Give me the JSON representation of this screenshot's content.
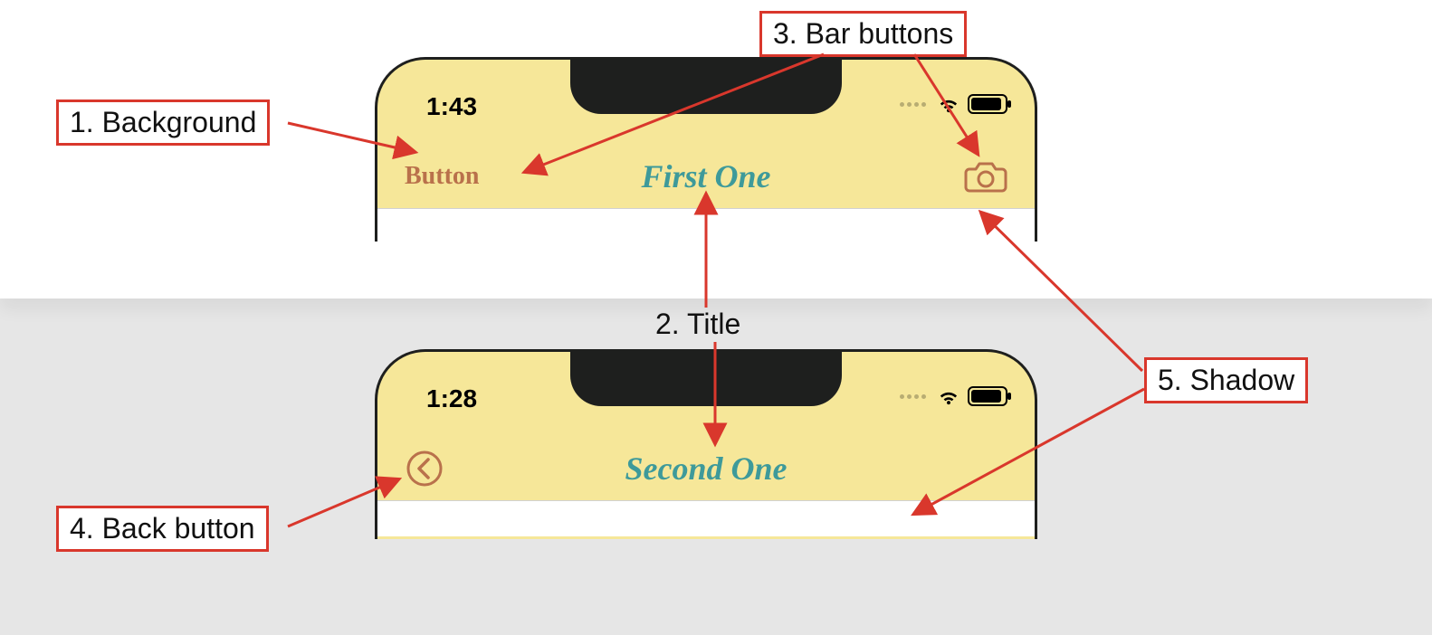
{
  "annotations": {
    "background": "1. Background",
    "title": "2. Title",
    "barButtons": "3. Bar buttons",
    "backButton": "4. Back button",
    "shadow": "5. Shadow"
  },
  "phones": {
    "first": {
      "time": "1:43",
      "leftButtonLabel": "Button",
      "title": "First One",
      "rightIcon": "camera-icon"
    },
    "second": {
      "time": "1:28",
      "leftIcon": "back-chevron-icon",
      "title": "Second One"
    }
  },
  "colors": {
    "navBackground": "#f6e799",
    "navTitle": "#3e9a9a",
    "barButton": "#b9714b",
    "calloutBorder": "#d9372c"
  }
}
